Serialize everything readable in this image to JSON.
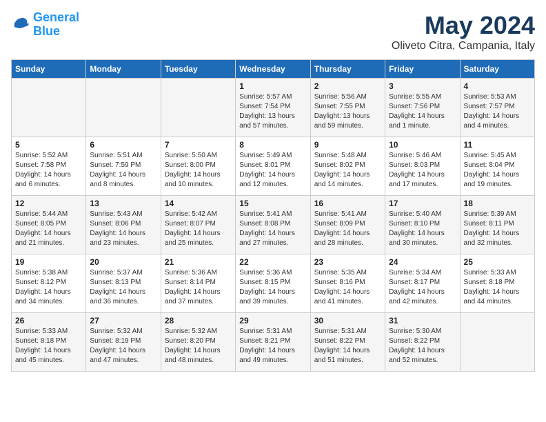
{
  "header": {
    "logo_line1": "General",
    "logo_line2": "Blue",
    "title": "May 2024",
    "subtitle": "Oliveto Citra, Campania, Italy"
  },
  "days_of_week": [
    "Sunday",
    "Monday",
    "Tuesday",
    "Wednesday",
    "Thursday",
    "Friday",
    "Saturday"
  ],
  "weeks": [
    [
      {
        "num": "",
        "info": ""
      },
      {
        "num": "",
        "info": ""
      },
      {
        "num": "",
        "info": ""
      },
      {
        "num": "1",
        "info": "Sunrise: 5:57 AM\nSunset: 7:54 PM\nDaylight: 13 hours\nand 57 minutes."
      },
      {
        "num": "2",
        "info": "Sunrise: 5:56 AM\nSunset: 7:55 PM\nDaylight: 13 hours\nand 59 minutes."
      },
      {
        "num": "3",
        "info": "Sunrise: 5:55 AM\nSunset: 7:56 PM\nDaylight: 14 hours\nand 1 minute."
      },
      {
        "num": "4",
        "info": "Sunrise: 5:53 AM\nSunset: 7:57 PM\nDaylight: 14 hours\nand 4 minutes."
      }
    ],
    [
      {
        "num": "5",
        "info": "Sunrise: 5:52 AM\nSunset: 7:58 PM\nDaylight: 14 hours\nand 6 minutes."
      },
      {
        "num": "6",
        "info": "Sunrise: 5:51 AM\nSunset: 7:59 PM\nDaylight: 14 hours\nand 8 minutes."
      },
      {
        "num": "7",
        "info": "Sunrise: 5:50 AM\nSunset: 8:00 PM\nDaylight: 14 hours\nand 10 minutes."
      },
      {
        "num": "8",
        "info": "Sunrise: 5:49 AM\nSunset: 8:01 PM\nDaylight: 14 hours\nand 12 minutes."
      },
      {
        "num": "9",
        "info": "Sunrise: 5:48 AM\nSunset: 8:02 PM\nDaylight: 14 hours\nand 14 minutes."
      },
      {
        "num": "10",
        "info": "Sunrise: 5:46 AM\nSunset: 8:03 PM\nDaylight: 14 hours\nand 17 minutes."
      },
      {
        "num": "11",
        "info": "Sunrise: 5:45 AM\nSunset: 8:04 PM\nDaylight: 14 hours\nand 19 minutes."
      }
    ],
    [
      {
        "num": "12",
        "info": "Sunrise: 5:44 AM\nSunset: 8:05 PM\nDaylight: 14 hours\nand 21 minutes."
      },
      {
        "num": "13",
        "info": "Sunrise: 5:43 AM\nSunset: 8:06 PM\nDaylight: 14 hours\nand 23 minutes."
      },
      {
        "num": "14",
        "info": "Sunrise: 5:42 AM\nSunset: 8:07 PM\nDaylight: 14 hours\nand 25 minutes."
      },
      {
        "num": "15",
        "info": "Sunrise: 5:41 AM\nSunset: 8:08 PM\nDaylight: 14 hours\nand 27 minutes."
      },
      {
        "num": "16",
        "info": "Sunrise: 5:41 AM\nSunset: 8:09 PM\nDaylight: 14 hours\nand 28 minutes."
      },
      {
        "num": "17",
        "info": "Sunrise: 5:40 AM\nSunset: 8:10 PM\nDaylight: 14 hours\nand 30 minutes."
      },
      {
        "num": "18",
        "info": "Sunrise: 5:39 AM\nSunset: 8:11 PM\nDaylight: 14 hours\nand 32 minutes."
      }
    ],
    [
      {
        "num": "19",
        "info": "Sunrise: 5:38 AM\nSunset: 8:12 PM\nDaylight: 14 hours\nand 34 minutes."
      },
      {
        "num": "20",
        "info": "Sunrise: 5:37 AM\nSunset: 8:13 PM\nDaylight: 14 hours\nand 36 minutes."
      },
      {
        "num": "21",
        "info": "Sunrise: 5:36 AM\nSunset: 8:14 PM\nDaylight: 14 hours\nand 37 minutes."
      },
      {
        "num": "22",
        "info": "Sunrise: 5:36 AM\nSunset: 8:15 PM\nDaylight: 14 hours\nand 39 minutes."
      },
      {
        "num": "23",
        "info": "Sunrise: 5:35 AM\nSunset: 8:16 PM\nDaylight: 14 hours\nand 41 minutes."
      },
      {
        "num": "24",
        "info": "Sunrise: 5:34 AM\nSunset: 8:17 PM\nDaylight: 14 hours\nand 42 minutes."
      },
      {
        "num": "25",
        "info": "Sunrise: 5:33 AM\nSunset: 8:18 PM\nDaylight: 14 hours\nand 44 minutes."
      }
    ],
    [
      {
        "num": "26",
        "info": "Sunrise: 5:33 AM\nSunset: 8:18 PM\nDaylight: 14 hours\nand 45 minutes."
      },
      {
        "num": "27",
        "info": "Sunrise: 5:32 AM\nSunset: 8:19 PM\nDaylight: 14 hours\nand 47 minutes."
      },
      {
        "num": "28",
        "info": "Sunrise: 5:32 AM\nSunset: 8:20 PM\nDaylight: 14 hours\nand 48 minutes."
      },
      {
        "num": "29",
        "info": "Sunrise: 5:31 AM\nSunset: 8:21 PM\nDaylight: 14 hours\nand 49 minutes."
      },
      {
        "num": "30",
        "info": "Sunrise: 5:31 AM\nSunset: 8:22 PM\nDaylight: 14 hours\nand 51 minutes."
      },
      {
        "num": "31",
        "info": "Sunrise: 5:30 AM\nSunset: 8:22 PM\nDaylight: 14 hours\nand 52 minutes."
      },
      {
        "num": "",
        "info": ""
      }
    ]
  ]
}
